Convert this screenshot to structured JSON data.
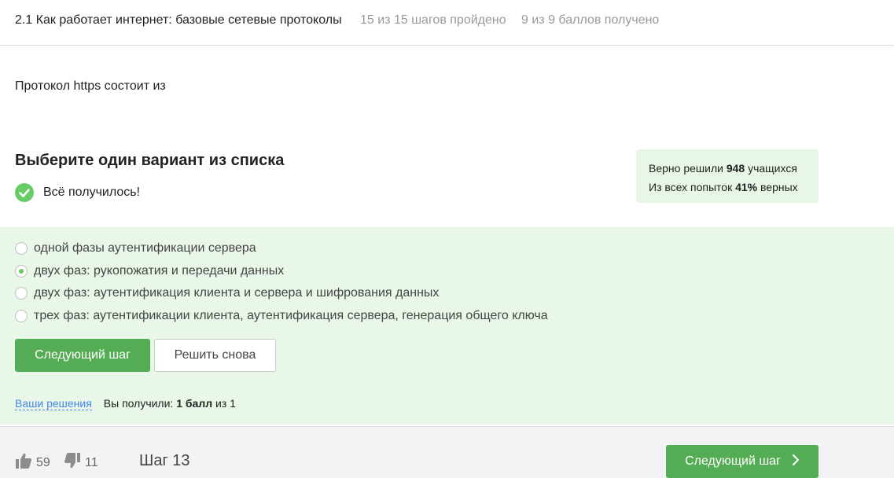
{
  "header": {
    "title": "2.1 Как работает интернет: базовые сетевые протоколы",
    "steps_progress": "15 из 15 шагов пройдено",
    "score_progress": "9 из 9 баллов  получено"
  },
  "question": {
    "text": "Протокол https состоит из"
  },
  "task": {
    "heading": "Выберите один вариант из списка",
    "status": "Всё получилось!"
  },
  "stats": {
    "line1_prefix": "Верно решили ",
    "line1_value": "948",
    "line1_suffix": " учащихся",
    "line2_prefix": "Из всех попыток ",
    "line2_value": "41%",
    "line2_suffix": " верных"
  },
  "options": [
    {
      "label": "одной фазы аутентификации сервера",
      "selected": false
    },
    {
      "label": "двух фаз: рукопожатия и передачи данных",
      "selected": true
    },
    {
      "label": "двух фаз: аутентификация клиента и сервера и шифрования данных",
      "selected": false
    },
    {
      "label": "трех фаз: аутентификации клиента, аутентификация сервера, генерация общего ключа",
      "selected": false
    }
  ],
  "actions": {
    "next_step": "Следующий шаг",
    "retry": "Решить снова"
  },
  "result": {
    "solutions_link": "Ваши решения",
    "score_prefix": "Вы получили: ",
    "score_value": "1 балл",
    "score_suffix": " из 1"
  },
  "footer": {
    "likes": "59",
    "dislikes": "11",
    "step_label": "Шаг 13",
    "next_step": "Следующий шаг"
  },
  "colors": {
    "accent": "#54ad54",
    "success": "#66cc66",
    "answer_bg": "#e9f7e9",
    "link": "#4485ed"
  }
}
